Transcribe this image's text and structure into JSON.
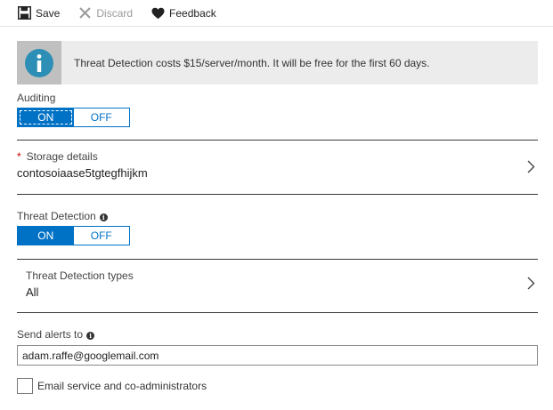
{
  "toolbar": {
    "save": {
      "label": "Save",
      "icon": "save-icon"
    },
    "discard": {
      "label": "Discard",
      "icon": "close-icon"
    },
    "feedback": {
      "label": "Feedback",
      "icon": "heart-icon"
    }
  },
  "banner": {
    "icon": "info-icon",
    "message": "Threat Detection costs $15/server/month. It will be free for the first 60 days."
  },
  "auditing": {
    "label": "Auditing",
    "on_label": "ON",
    "off_label": "OFF",
    "selected": "ON"
  },
  "storage": {
    "required_mark": "*",
    "title": "Storage details",
    "value": "contosoiaase5tgtegfhijkm"
  },
  "threat_detection": {
    "label": "Threat Detection",
    "on_label": "ON",
    "off_label": "OFF",
    "selected": "ON"
  },
  "threat_types": {
    "title": "Threat Detection types",
    "value": "All"
  },
  "alerts": {
    "label": "Send alerts to",
    "value": "adam.raffe@googlemail.com"
  },
  "email_admins": {
    "label": "Email service and co-administrators",
    "checked": false
  },
  "colors": {
    "accent": "#0072c6",
    "banner_bg": "#ececec",
    "info_icon": "#2d8fb5"
  }
}
